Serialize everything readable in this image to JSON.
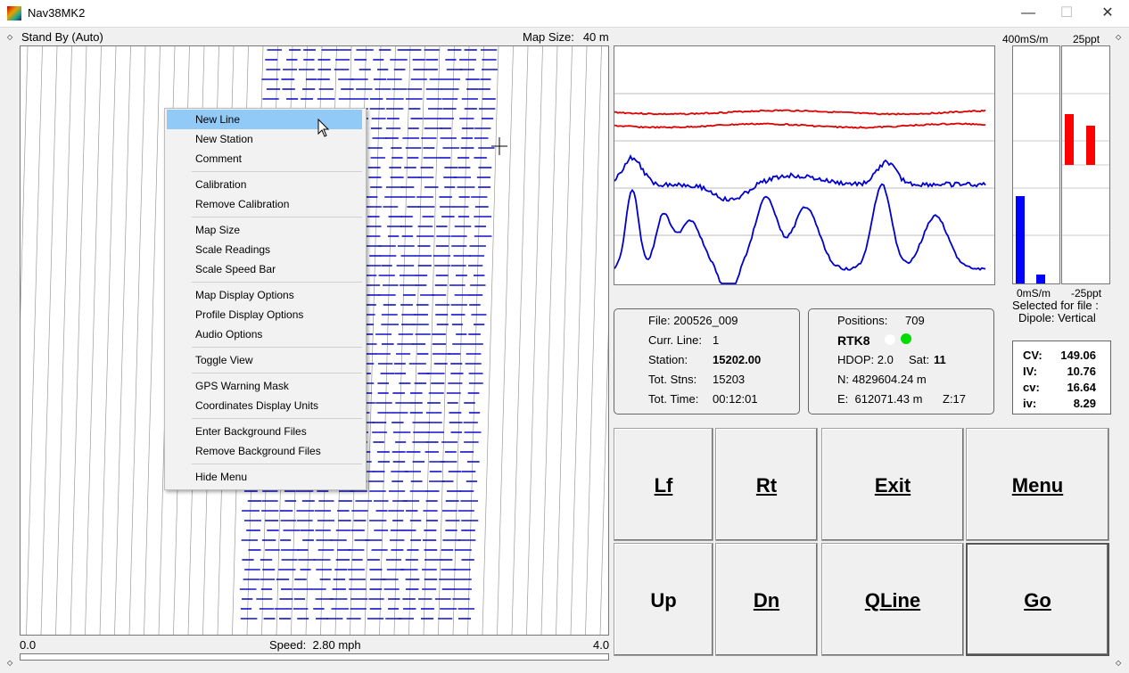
{
  "window": {
    "title": "Nav38MK2",
    "minimize_label": "—",
    "maximize_label": "☐",
    "close_label": "✕"
  },
  "status": {
    "mode": "Stand By (Auto)",
    "map_size_label": "Map Size:",
    "map_size_value": "40 m"
  },
  "map": {
    "scale_min": "0.0",
    "scale_max": "4.0",
    "speed_label": "Speed:",
    "speed_value": "2.80 mph"
  },
  "context_menu": {
    "items": [
      "New Line",
      "New Station",
      "Comment",
      "Calibration",
      "Remove Calibration",
      "Map Size",
      "Scale Readings",
      "Scale Speed Bar",
      "Map Display Options",
      "Profile Display Options",
      "Audio Options",
      "Toggle View",
      "GPS Warning Mask",
      "Coordinates Display Units",
      "Enter Background Files",
      "Remove Background Files",
      "Hide Menu"
    ],
    "selected": "New Line"
  },
  "bars": {
    "left_top": "400mS/m",
    "left_bottom": "0mS/m",
    "right_top": "25ppt",
    "right_bottom": "-25ppt",
    "selected_label": "Selected for file :",
    "selected_value": "Dipole: Vertical",
    "colors": {
      "conductivity": "#0000ff",
      "inphase": "#ff0000"
    }
  },
  "file_info": {
    "file_label": "File:",
    "file_value": "200526_009",
    "line_label": "Curr. Line:",
    "line_value": "1",
    "station_label": "Station:",
    "station_value": "15202.00",
    "stns_label": "Tot. Stns:",
    "stns_value": "15203",
    "time_label": "Tot. Time:",
    "time_value": "00:12:01"
  },
  "gps_info": {
    "positions_label": "Positions:",
    "positions_value": "709",
    "fix": "RTK8",
    "hdop_label": "HDOP:",
    "hdop_value": "2.0",
    "sat_label": "Sat:",
    "sat_value": "11",
    "n_label": "N:",
    "n_value": "4829604.24 m",
    "e_label": "E:",
    "e_value": "612071.43 m",
    "z_label": "Z:17",
    "status_colors": [
      "#ffffff",
      "#00dd00"
    ]
  },
  "readings": {
    "cv_label": "CV:",
    "cv_value": "149.06",
    "iv_label": "IV:",
    "iv_value": "10.76",
    "cv2_label": "cv:",
    "cv2_value": "16.64",
    "iv2_label": "iv:",
    "iv2_value": "8.29"
  },
  "buttons": {
    "lf": "Lf",
    "rt": "Rt",
    "exit": "Exit",
    "menu": "Menu",
    "up": "Up",
    "dn": "Dn",
    "qline": "QLine",
    "go": "Go"
  }
}
